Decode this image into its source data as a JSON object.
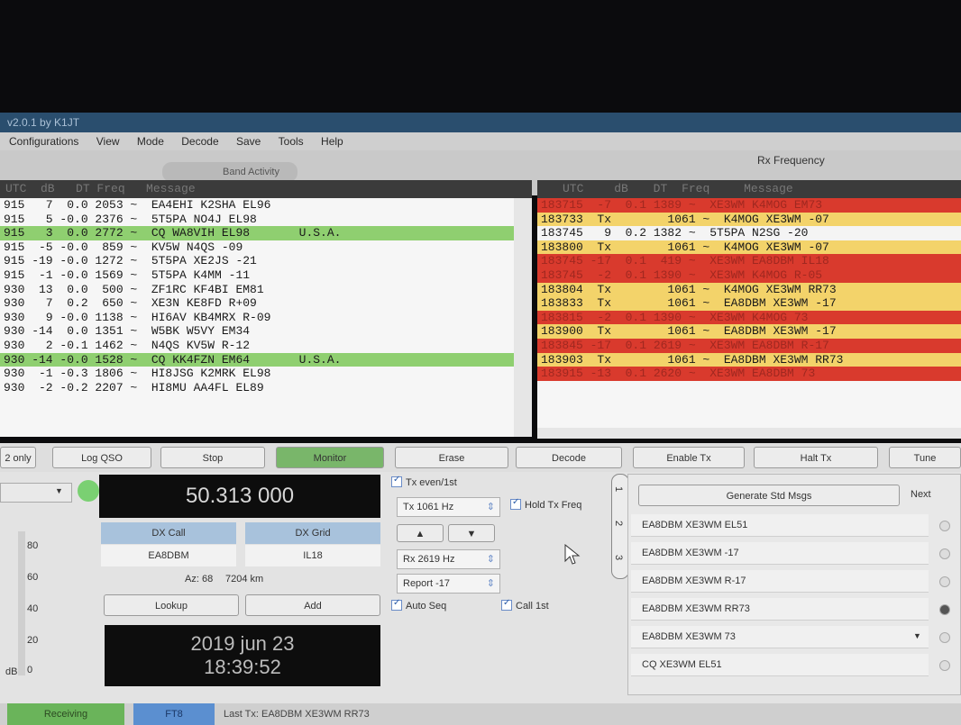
{
  "window": {
    "title": "v2.0.1 by K1JT"
  },
  "menu": [
    "Configurations",
    "View",
    "Mode",
    "Decode",
    "Save",
    "Tools",
    "Help"
  ],
  "activity_tab": "Band Activity",
  "right_label": "Rx Frequency",
  "band_activity_header": "UTC  dB   DT Freq   Message",
  "rx_header": {
    "utc": "UTC",
    "db": "dB",
    "dt": "DT",
    "freq": "Freq",
    "msg": "Message"
  },
  "band_rows": [
    {
      "text": "915   7  0.0 2053 ~  EA4EHI K2SHA EL96",
      "hl": ""
    },
    {
      "text": "915   5 -0.0 2376 ~  5T5PA NO4J EL98",
      "hl": ""
    },
    {
      "text": "915   3  0.0 2772 ~  CQ WA8VIH EL98       U.S.A.",
      "hl": "green"
    },
    {
      "text": "915  -5 -0.0  859 ~  KV5W N4QS -09",
      "hl": ""
    },
    {
      "text": "915 -19 -0.0 1272 ~  5T5PA XE2JS -21",
      "hl": ""
    },
    {
      "text": "915  -1 -0.0 1569 ~  5T5PA K4MM -11",
      "hl": ""
    },
    {
      "text": "930  13  0.0  500 ~  ZF1RC KF4BI EM81",
      "hl": ""
    },
    {
      "text": "930   7  0.2  650 ~  XE3N KE8FD R+09",
      "hl": ""
    },
    {
      "text": "930   9 -0.0 1138 ~  HI6AV KB4MRX R-09",
      "hl": ""
    },
    {
      "text": "930 -14  0.0 1351 ~  W5BK W5VY EM34",
      "hl": ""
    },
    {
      "text": "930   2 -0.1 1462 ~  N4QS KV5W R-12",
      "hl": ""
    },
    {
      "text": "930 -14 -0.0 1528 ~  CQ KK4FZN EM64       U.S.A.",
      "hl": "green"
    },
    {
      "text": "930  -1 -0.3 1806 ~  HI8JSG K2MRK EL98",
      "hl": ""
    },
    {
      "text": "930  -2 -0.2 2207 ~  HI8MU AA4FL EL89",
      "hl": ""
    }
  ],
  "rx_rows": [
    {
      "text": "183715  -7  0.1 1389 ~  XE3WM K4MOG EM73",
      "hl": "red"
    },
    {
      "text": "183733  Tx        1061 ~  K4MOG XE3WM -07",
      "hl": "yellow"
    },
    {
      "text": "183745   9  0.2 1382 ~  5T5PA N2SG -20",
      "hl": "white"
    },
    {
      "text": "183800  Tx        1061 ~  K4MOG XE3WM -07",
      "hl": "yellow"
    },
    {
      "text": "183745 -17  0.1  419 ~  XE3WM EA8DBM IL18",
      "hl": "red"
    },
    {
      "text": "183745  -2  0.1 1390 ~  XE3WM K4MOG R-05",
      "hl": "red"
    },
    {
      "text": "183804  Tx        1061 ~  K4MOG XE3WM RR73",
      "hl": "yellow"
    },
    {
      "text": "183833  Tx        1061 ~  EA8DBM XE3WM -17",
      "hl": "yellow"
    },
    {
      "text": "183815  -2  0.1 1390 ~  XE3WM K4MOG 73",
      "hl": "red"
    },
    {
      "text": "183900  Tx        1061 ~  EA8DBM XE3WM -17",
      "hl": "yellow"
    },
    {
      "text": "183845 -17  0.1 2619 ~  XE3WM EA8DBM R-17",
      "hl": "red"
    },
    {
      "text": "183903  Tx        1061 ~  EA8DBM XE3WM RR73",
      "hl": "yellow"
    },
    {
      "text": "183915 -13  0.1 2620 ~  XE3WM EA8DBM 73",
      "hl": "red"
    }
  ],
  "buttons": {
    "cq_only": "2 only",
    "log_qso": "Log QSO",
    "stop": "Stop",
    "monitor": "Monitor",
    "erase": "Erase",
    "decode": "Decode",
    "enable_tx": "Enable Tx",
    "halt_tx": "Halt Tx",
    "tune": "Tune"
  },
  "frequency": "50.313 000",
  "dx": {
    "call_label": "DX Call",
    "grid_label": "DX Grid",
    "call": "EA8DBM",
    "grid": "IL18",
    "az": "Az: 68",
    "dist": "7204 km",
    "lookup": "Lookup",
    "add": "Add"
  },
  "datetime": {
    "date": "2019 jun 23",
    "time": "18:39:52"
  },
  "controls": {
    "tx_even": "Tx even/1st",
    "tx_hz": "Tx  1061  Hz",
    "hold_tx": "Hold Tx Freq",
    "rx_hz": "Rx  2619  Hz",
    "report": "Report -17",
    "auto_seq": "Auto Seq",
    "call_1st": "Call 1st",
    "up": "▲",
    "down": "▼",
    "spin": "⇕"
  },
  "tabs": [
    "1",
    "2",
    "3"
  ],
  "std_msgs": {
    "generate": "Generate Std Msgs",
    "next": "Next",
    "items": [
      "EA8DBM XE3WM EL51",
      "EA8DBM XE3WM -17",
      "EA8DBM XE3WM R-17",
      "EA8DBM XE3WM RR73",
      "EA8DBM XE3WM 73",
      "CQ XE3WM EL51"
    ],
    "selected_index": 3
  },
  "meter": {
    "ticks": [
      "80",
      "60",
      "40",
      "20",
      "0"
    ],
    "unit": "dB"
  },
  "status": {
    "receiving": "Receiving",
    "mode": "FT8",
    "last_tx": "Last Tx: EA8DBM XE3WM RR73"
  },
  "colors": {
    "green": "#8fcf70",
    "red": "#d93a2d",
    "yellow": "#f3d36a",
    "monitor": "#79b66a",
    "freq_bg": "#0d0d0d"
  },
  "icons": {
    "dropdown": "chevron-down-icon",
    "led": "status-led-icon",
    "cursor": "mouse-pointer-icon"
  }
}
